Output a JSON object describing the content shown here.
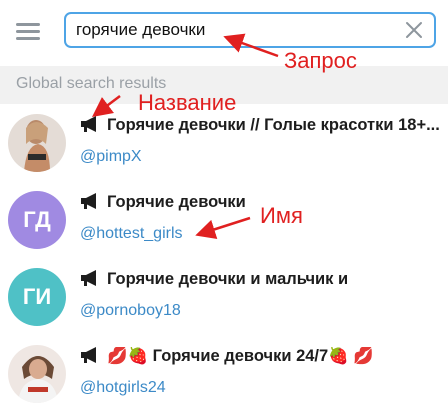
{
  "search": {
    "value": "горячие девочки"
  },
  "section_title": "Global search results",
  "results": [
    {
      "title": "Горячие девочки // Голые красотки 18+...",
      "handle": "@pimpX",
      "avatar_initials": "",
      "avatar_color": "#d8c7bd"
    },
    {
      "title": "Горячие девочки",
      "handle": "@hottest_girls",
      "avatar_initials": "ГД",
      "avatar_color": "#a08ae2"
    },
    {
      "title": "Горячие девочки и мальчик и",
      "handle": "@pornoboy18",
      "avatar_initials": "ГИ",
      "avatar_color": "#4fc1c6"
    },
    {
      "title": "💋🍓 Горячие девочки 24/7🍓 💋",
      "handle": "@hotgirls24",
      "avatar_initials": "",
      "avatar_color": "#e7d6d6"
    }
  ],
  "annotations": {
    "query": "Запрос",
    "title": "Название",
    "name": "Имя"
  },
  "icons": {
    "menu": "hamburger-menu-icon",
    "clear": "close-icon",
    "channel": "megaphone-icon"
  },
  "colors": {
    "search_border": "#4ea4e6",
    "link": "#3c8ac7",
    "annotation": "#e02020",
    "section_bg": "#f1f1f1"
  }
}
